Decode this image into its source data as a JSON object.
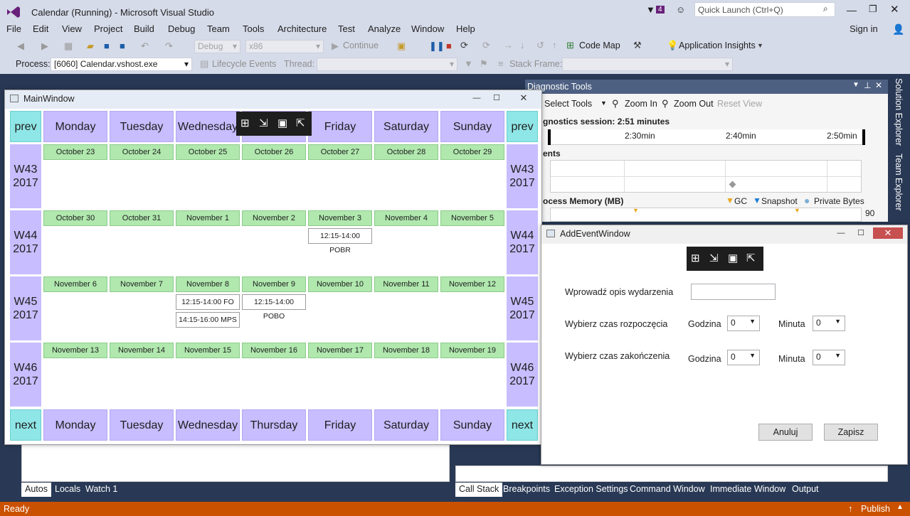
{
  "titlebar": {
    "title": "Calendar (Running) - Microsoft Visual Studio",
    "notif_count": "4",
    "quick_launch": "Quick Launch (Ctrl+Q)"
  },
  "menu": [
    "File",
    "Edit",
    "View",
    "Project",
    "Build",
    "Debug",
    "Team",
    "Tools",
    "Architecture",
    "Test",
    "Analyze",
    "Window",
    "Help"
  ],
  "signin": "Sign in",
  "toolbar": {
    "config": "Debug",
    "platform": "x86",
    "continue": "Continue",
    "codemap": "Code Map",
    "insights": "Application Insights"
  },
  "procbar": {
    "process_label": "Process:",
    "process_value": "[6060] Calendar.vshost.exe",
    "lifecycle": "Lifecycle Events",
    "thread_label": "Thread:",
    "stackframe_label": "Stack Frame:"
  },
  "mainwindow": {
    "title": "MainWindow",
    "prev": "prev",
    "next": "next",
    "days": [
      "Monday",
      "Tuesday",
      "Wednesday",
      "Thursday",
      "Friday",
      "Saturday",
      "Sunday"
    ],
    "weeks": [
      {
        "label": "W43 2017",
        "dates": [
          "October 23",
          "October 24",
          "October 25",
          "October 26",
          "October 27",
          "October 28",
          "October 29"
        ]
      },
      {
        "label": "W44 2017",
        "dates": [
          "October 30",
          "October 31",
          "November 1",
          "November 2",
          "November 3",
          "November 4",
          "November 5"
        ]
      },
      {
        "label": "W45 2017",
        "dates": [
          "November 6",
          "November 7",
          "November 8",
          "November 9",
          "November 10",
          "November 11",
          "November 12"
        ]
      },
      {
        "label": "W46 2017",
        "dates": [
          "November 13",
          "November 14",
          "November 15",
          "November 16",
          "November 17",
          "November 18",
          "November 19"
        ]
      }
    ],
    "events": [
      "12:15-14:00 POBR",
      "12:15-14:00 FO",
      "14:15-16:00 MPS",
      "12:15-14:00 POBO"
    ]
  },
  "diagnostic": {
    "title": "Diagnostic Tools",
    "select_tools": "Select Tools",
    "zoom_in": "Zoom In",
    "zoom_out": "Zoom Out",
    "reset_view": "Reset View",
    "session": "gnostics session: 2:51 minutes",
    "ticks": [
      "2:30min",
      "2:40min",
      "2:50min"
    ],
    "events_label": "ents",
    "memory_label": "ocess Memory (MB)",
    "legend": [
      "GC",
      "Snapshot",
      "Private Bytes"
    ],
    "y_value": "90"
  },
  "addevent": {
    "title": "AddEventWindow",
    "desc_label": "Wprowadź opis wydarzenia",
    "start_label": "Wybierz czas rozpoczęcia",
    "end_label": "Wybierz czas zakończenia",
    "hour_label": "Godzina",
    "minute_label": "Minuta",
    "start_hour": "0",
    "start_minute": "0",
    "end_hour": "0",
    "end_minute": "0",
    "cancel": "Anuluj",
    "save": "Zapisz"
  },
  "bottom_left_tabs": [
    "Autos",
    "Locals",
    "Watch 1"
  ],
  "bottom_right_tabs": [
    "Call Stack",
    "Breakpoints",
    "Exception Settings",
    "Command Window",
    "Immediate Window",
    "Output"
  ],
  "side_tabs": [
    "Solution Explorer",
    "Team Explorer"
  ],
  "status": {
    "text": "Ready",
    "publish": "Publish"
  },
  "colors": {
    "accent": "#CA5100",
    "day_header": "#C7BDFF",
    "nav": "#8FE6E6",
    "date": "#B0E8AE"
  }
}
